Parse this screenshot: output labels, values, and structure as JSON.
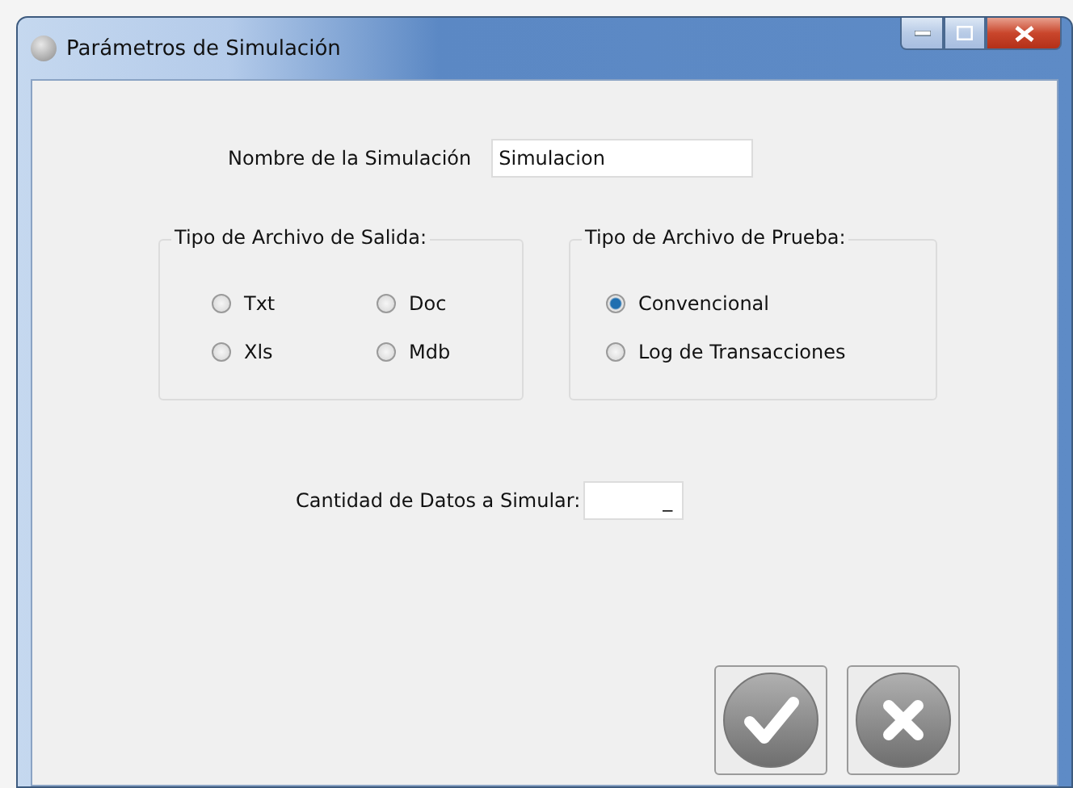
{
  "window": {
    "title": "Parámetros de Simulación"
  },
  "name_field": {
    "label": "Nombre de la Simulación",
    "value": "Simulacion"
  },
  "output_group": {
    "title": "Tipo de Archivo de Salida:",
    "options": [
      {
        "label": "Txt",
        "selected": false
      },
      {
        "label": "Doc",
        "selected": false
      },
      {
        "label": "Xls",
        "selected": false
      },
      {
        "label": "Mdb",
        "selected": false
      }
    ]
  },
  "test_group": {
    "title": "Tipo de Archivo de Prueba:",
    "options": [
      {
        "label": "Convencional",
        "selected": true
      },
      {
        "label": "Log de Transacciones",
        "selected": false
      }
    ]
  },
  "count_field": {
    "label": "Cantidad de Datos a Simular:",
    "value": "_"
  },
  "buttons": [
    {
      "kind": "accept"
    },
    {
      "kind": "cancel"
    }
  ]
}
